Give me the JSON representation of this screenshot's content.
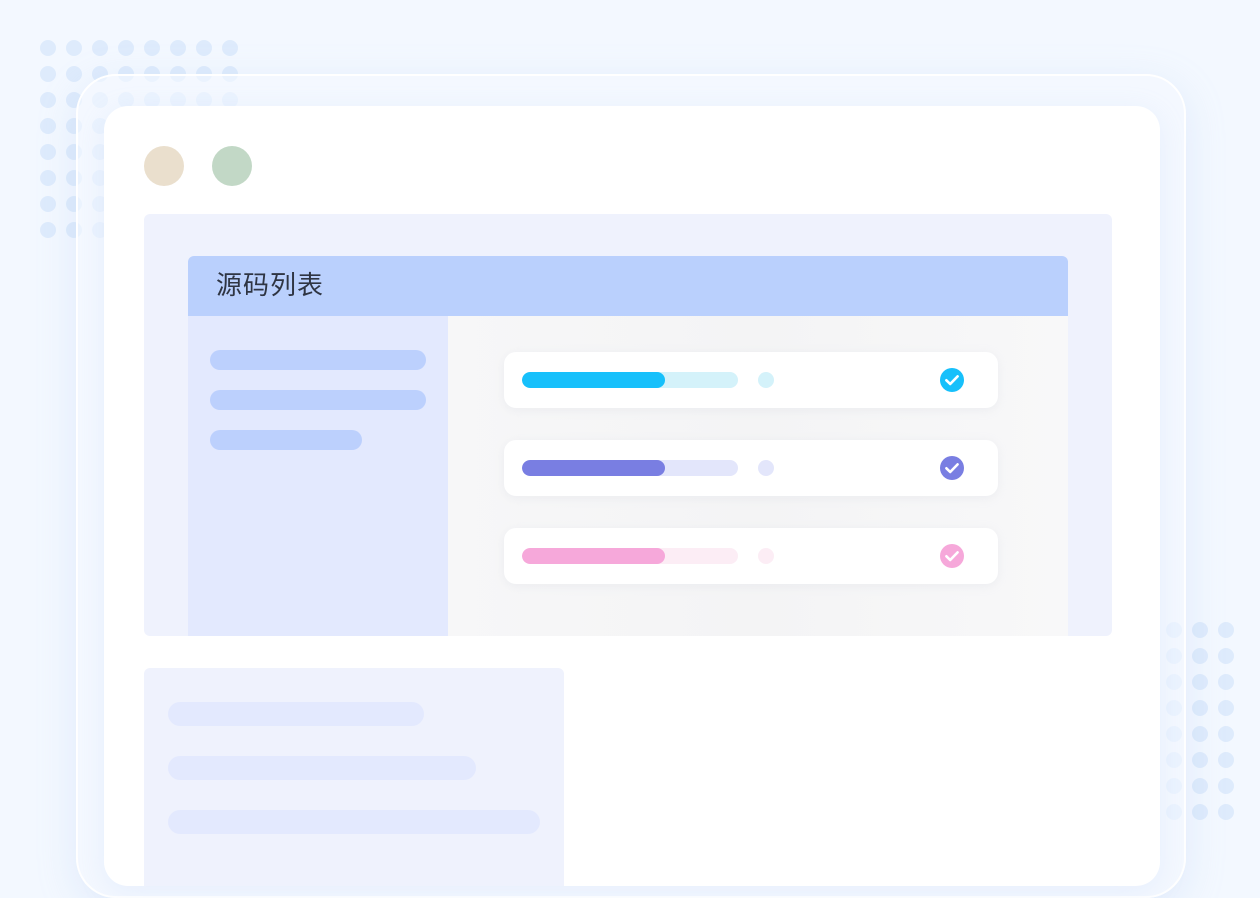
{
  "panel": {
    "title": "源码列表"
  },
  "colors": {
    "background": "#f3f8ff",
    "window": "#ffffff",
    "header": "#bad0fd",
    "sidebar": "#e3e9fe",
    "sidebar_placeholder": "#bcd0fd",
    "content": "#f5f5f6",
    "window_dot_1": "#eadfcd",
    "window_dot_2": "#c2d8c6"
  },
  "rows": [
    {
      "icon": "check-circle-icon",
      "progress": 0.66,
      "color": "#17c0fb",
      "track_color": "#d4f2fa",
      "dot_color": "#d4f2fa"
    },
    {
      "icon": "check-circle-icon",
      "progress": 0.66,
      "color": "#797ee2",
      "track_color": "#e3e6fb",
      "dot_color": "#e3e6fb"
    },
    {
      "icon": "check-circle-icon",
      "progress": 0.66,
      "color": "#f6a8da",
      "track_color": "#fcedf5",
      "dot_color": "#fcedf5"
    }
  ]
}
